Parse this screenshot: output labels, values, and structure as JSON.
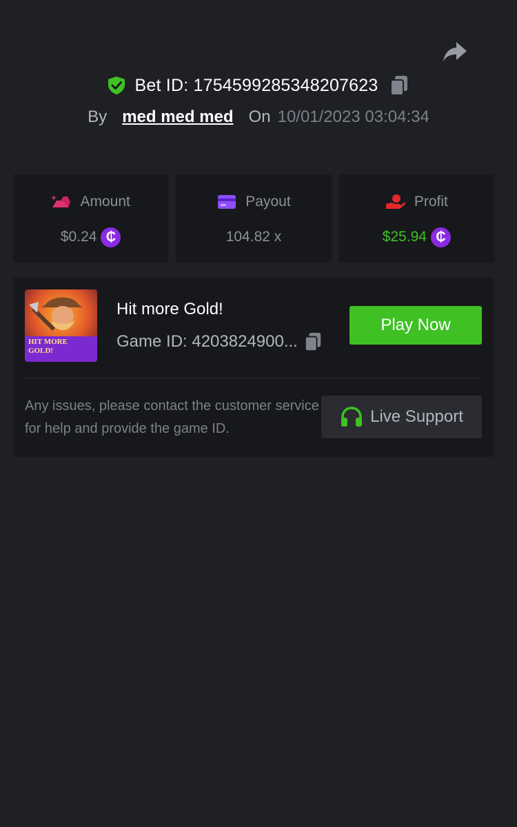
{
  "header": {
    "bet_id_label": "Bet ID: 1754599285348207623",
    "by_label": "By",
    "username": "med med med",
    "on_label": "On",
    "date": "10/01/2023 03:04:34",
    "icons": [
      "share-icon",
      "shield-check-icon",
      "copy-icon"
    ]
  },
  "stats": [
    {
      "label": "Amount",
      "value": "$0.24",
      "icon": "gold-bar-icon",
      "coin": "₵",
      "value_color": "#8d9099"
    },
    {
      "label": "Payout",
      "value": "104.82 x",
      "icon": "card-icon",
      "value_color": "#8d9099"
    },
    {
      "label": "Profit",
      "value": "$25.94",
      "icon": "hand-coin-icon",
      "coin": "₵",
      "value_color": "#3fc124"
    }
  ],
  "game": {
    "title": "Hit more Gold!",
    "game_id_label": "Game ID: 4203824900...",
    "thumb_text": "HIT MORE GOLD!",
    "play_label": "Play Now",
    "help_text": "Any issues, please contact the customer service for help and provide the game ID.",
    "support_label": "Live Support"
  },
  "colors": {
    "background": "#1f2024",
    "card": "#17181b",
    "accent_green": "#3fc124",
    "coin_purple": "#8a2be2",
    "amount_pink": "#e0306e",
    "payout_purple": "#8e4dff",
    "profit_red": "#e02a2a"
  }
}
